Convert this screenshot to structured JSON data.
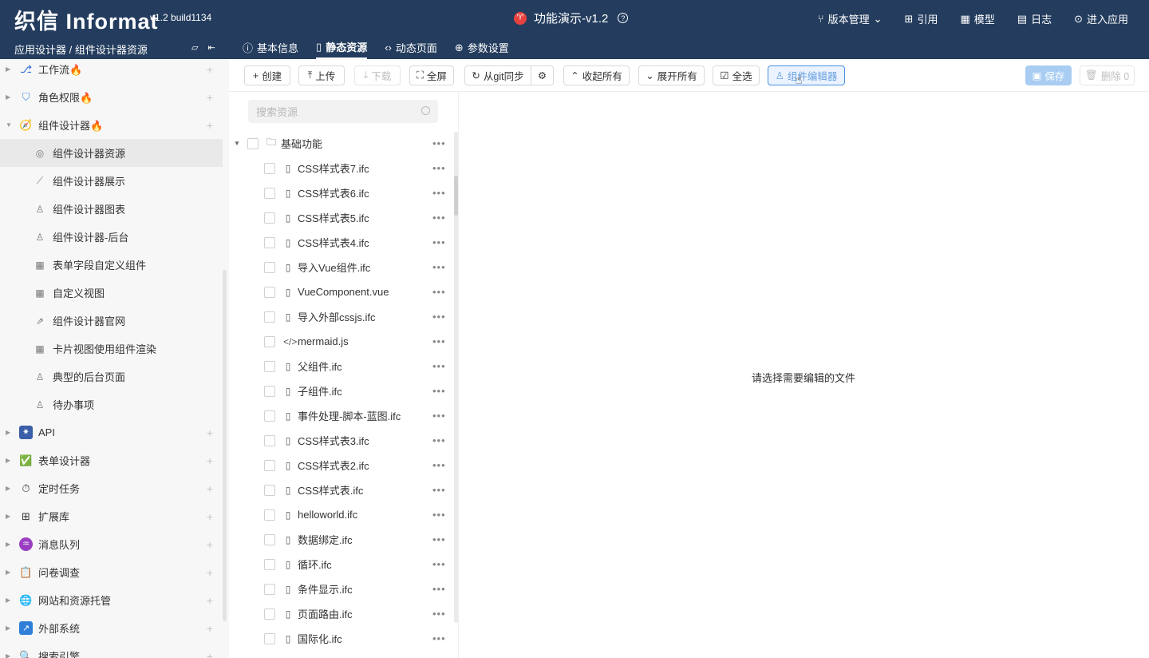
{
  "header": {
    "logo": "织信 Informat",
    "version": "v1.2 build1134",
    "app_logo_glyph": "♈",
    "app_title": "功能演示-v1.2",
    "nav": [
      {
        "icon": "branch-icon",
        "glyph": "⑂",
        "label": "版本管理",
        "caret": "⌄"
      },
      {
        "icon": "reference-icon",
        "glyph": "⊞",
        "label": "引用"
      },
      {
        "icon": "model-icon",
        "glyph": "▦",
        "label": "模型"
      },
      {
        "icon": "log-icon",
        "glyph": "▤",
        "label": "日志"
      },
      {
        "icon": "enter-app-icon",
        "glyph": "⊙",
        "label": "进入应用"
      }
    ]
  },
  "subbar": {
    "breadcrumb": "应用设计器 / 组件设计器资源",
    "tabs": [
      {
        "glyph": "ⓘ",
        "label": "基本信息"
      },
      {
        "glyph": "▯",
        "label": "静态资源"
      },
      {
        "glyph": "‹›",
        "label": "动态页面"
      },
      {
        "glyph": "⊕",
        "label": "参数设置"
      }
    ]
  },
  "sidebar": {
    "top_items": [
      {
        "label": "工作流🔥",
        "icon": "workflow-icon",
        "glyph": "⎇",
        "color": "#2f6bd8"
      },
      {
        "label": "角色权限🔥",
        "icon": "shield-icon",
        "glyph": "⛉",
        "color": "#4a90e2"
      },
      {
        "label": "组件设计器🔥",
        "icon": "compass-icon",
        "glyph": "🧭",
        "color": "#f0a020"
      }
    ],
    "children": [
      {
        "label": "组件设计器资源",
        "glyph": "◎",
        "icon": "resource-icon"
      },
      {
        "label": "组件设计器展示",
        "glyph": "⟋",
        "icon": "chart-line-icon"
      },
      {
        "label": "组件设计器图表",
        "glyph": "♙",
        "icon": "person-icon"
      },
      {
        "label": "组件设计器-后台",
        "glyph": "♙",
        "icon": "person-icon"
      },
      {
        "label": "表单字段自定义组件",
        "glyph": "▦",
        "icon": "table-icon"
      },
      {
        "label": "自定义视图",
        "glyph": "▦",
        "icon": "table-icon"
      },
      {
        "label": "组件设计器官网",
        "glyph": "⇗",
        "icon": "external-link-icon"
      },
      {
        "label": "卡片视图使用组件渲染",
        "glyph": "▦",
        "icon": "table-icon"
      },
      {
        "label": "典型的后台页面",
        "glyph": "♙",
        "icon": "person-icon"
      },
      {
        "label": "待办事项",
        "glyph": "♙",
        "icon": "person-icon"
      }
    ],
    "bottom_items": [
      {
        "label": "API",
        "icon": "api-icon",
        "glyph": "✷",
        "color": "#3a5fa8"
      },
      {
        "label": "表单设计器",
        "icon": "check-icon",
        "glyph": "✅",
        "color": "#3aa757"
      },
      {
        "label": "定时任务",
        "icon": "timer-icon",
        "glyph": "⏱",
        "color": "#555555"
      },
      {
        "label": "扩展库",
        "icon": "library-icon",
        "glyph": "⊞",
        "color": "#555555"
      },
      {
        "label": "消息队列",
        "icon": "queue-icon",
        "glyph": "♒",
        "color": "#9b3fc2"
      },
      {
        "label": "问卷调查",
        "icon": "clipboard-icon",
        "glyph": "📋",
        "color": "#b07a3a"
      },
      {
        "label": "网站和资源托管",
        "icon": "globe-icon",
        "glyph": "🌐",
        "color": "#2f7fd8"
      },
      {
        "label": "外部系统",
        "icon": "external-system-icon",
        "glyph": "↗",
        "color": "#2f7fd8"
      },
      {
        "label": "搜索引擎",
        "icon": "search-engine-icon",
        "glyph": "🔍",
        "color": "#2f7fd8"
      }
    ]
  },
  "toolbar": {
    "create": "创建",
    "upload": "上传",
    "download": "下载",
    "fullscreen": "全屏",
    "git_sync": "从git同步",
    "collapse_all": "收起所有",
    "expand_all": "展开所有",
    "select_all": "全选",
    "component_editor": "组件编辑器",
    "save": "保存",
    "delete": "删除 0"
  },
  "tree": {
    "search_placeholder": "搜索资源",
    "folder": "基础功能",
    "files": [
      {
        "name": "CSS样式表7.ifc",
        "glyph": "▯"
      },
      {
        "name": "CSS样式表6.ifc",
        "glyph": "▯"
      },
      {
        "name": "CSS样式表5.ifc",
        "glyph": "▯"
      },
      {
        "name": "CSS样式表4.ifc",
        "glyph": "▯"
      },
      {
        "name": "导入Vue组件.ifc",
        "glyph": "▯"
      },
      {
        "name": "VueComponent.vue",
        "glyph": "▯"
      },
      {
        "name": "导入外部cssjs.ifc",
        "glyph": "▯"
      },
      {
        "name": "mermaid.js",
        "glyph": "</>"
      },
      {
        "name": "父组件.ifc",
        "glyph": "▯"
      },
      {
        "name": "子组件.ifc",
        "glyph": "▯"
      },
      {
        "name": "事件处理-脚本-蓝图.ifc",
        "glyph": "▯"
      },
      {
        "name": "CSS样式表3.ifc",
        "glyph": "▯"
      },
      {
        "name": "CSS样式表2.ifc",
        "glyph": "▯"
      },
      {
        "name": "CSS样式表.ifc",
        "glyph": "▯"
      },
      {
        "name": "helloworld.ifc",
        "glyph": "▯"
      },
      {
        "name": "数据绑定.ifc",
        "glyph": "▯"
      },
      {
        "name": "循环.ifc",
        "glyph": "▯"
      },
      {
        "name": "条件显示.ifc",
        "glyph": "▯"
      },
      {
        "name": "页面路由.ifc",
        "glyph": "▯"
      },
      {
        "name": "国际化.ifc",
        "glyph": "▯"
      }
    ]
  },
  "main": {
    "empty_text": "请选择需要编辑的文件"
  }
}
